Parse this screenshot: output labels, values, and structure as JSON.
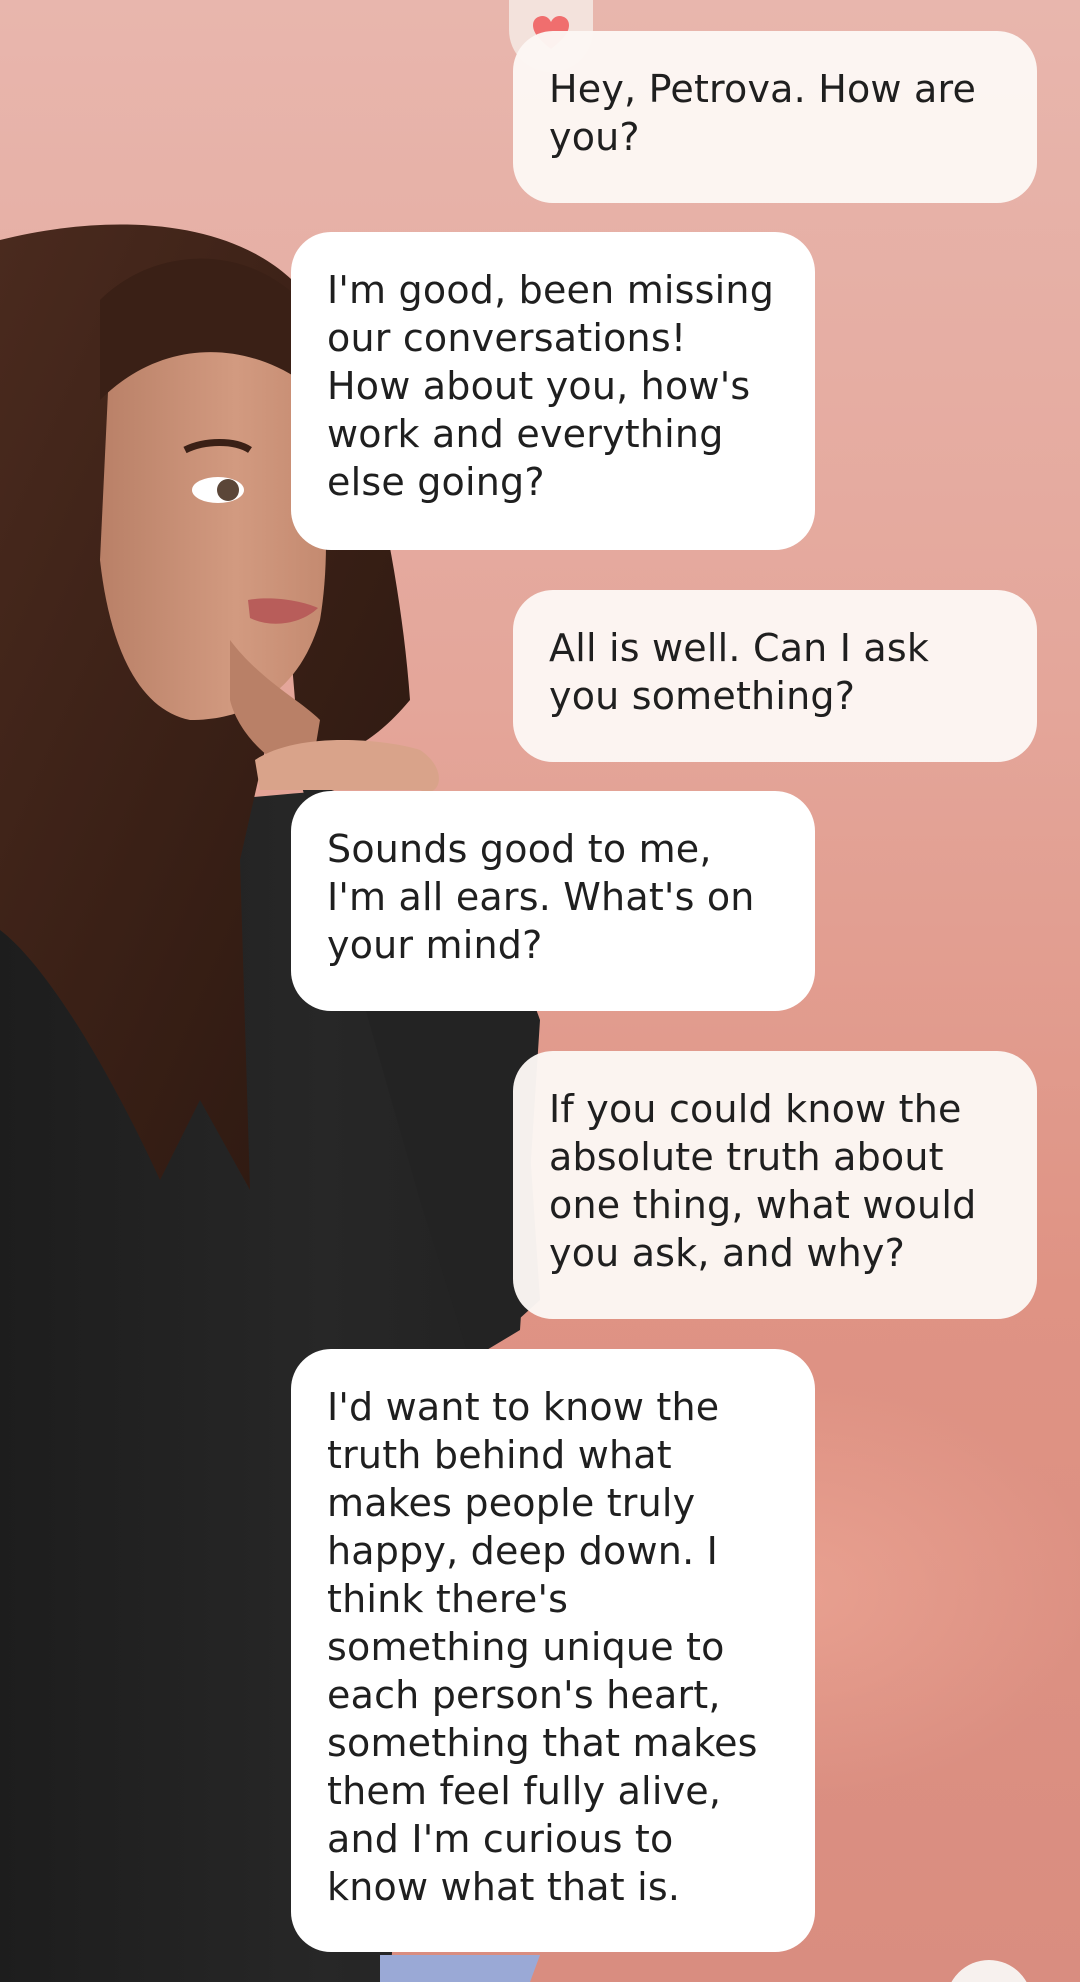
{
  "header": {
    "favorite_icon": "heart-icon",
    "favorite_color": "#f06e6e"
  },
  "avatar": {
    "icon": "avatar-3d-figure"
  },
  "messages": [
    {
      "role": "user",
      "text": "Hey, Petrova. How are you?"
    },
    {
      "role": "bot",
      "text": "I'm good, been missing our conversations! How about you, how's work and everything else going?"
    },
    {
      "role": "user",
      "text": "All is well. Can I ask you something?"
    },
    {
      "role": "bot",
      "text": "Sounds good to me, I'm all ears. What's on your mind?"
    },
    {
      "role": "user",
      "text": "If you could know the absolute truth about one thing, what would you ask, and why?"
    },
    {
      "role": "bot",
      "text": "I'd want to know the truth behind what makes people truly happy, deep down. I think there's something unique to each person's heart, something that makes them feel fully alive, and I'm curious to know what that is."
    }
  ]
}
